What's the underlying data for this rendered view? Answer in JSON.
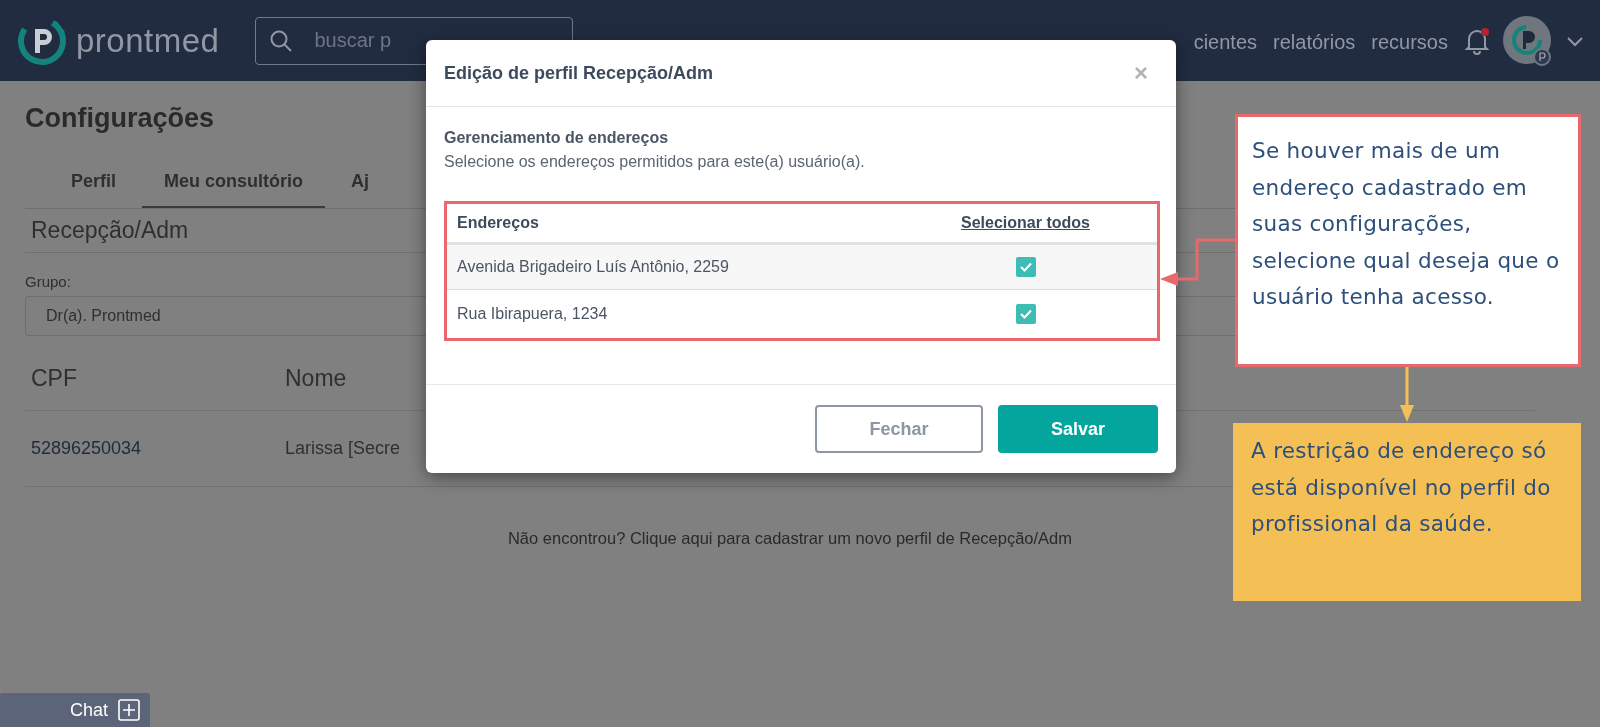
{
  "header": {
    "logo": "prontmed",
    "search": {
      "placeholder": "buscar p"
    },
    "nav": [
      {
        "label": "cientes"
      },
      {
        "label": "relatórios"
      },
      {
        "label": "recursos"
      }
    ]
  },
  "page": {
    "title": "Configurações",
    "tabs": [
      {
        "label": "Perfil",
        "selected": false
      },
      {
        "label": "Meu consultório",
        "selected": true
      },
      {
        "label": "Aj",
        "selected": false
      }
    ],
    "section": "Recepção/Adm",
    "group": {
      "label": "Grupo:",
      "value": "Dr(a). Prontmed"
    },
    "table": {
      "columns": [
        "CPF",
        "Nome"
      ],
      "rows": [
        [
          "52896250034",
          "Larissa [Secre"
        ]
      ]
    },
    "footer_link": "Não encontrou? Clique aqui para cadastrar um novo perfil de Recepção/Adm"
  },
  "modal": {
    "title": "Edição de perfil Recepção/Adm",
    "close": "×",
    "subtitle": "Gerenciamento de endereços",
    "description": "Selecione os endereços permitidos para este(a) usuário(a).",
    "columns": [
      "Endereços",
      "Selecionar todos"
    ],
    "addresses": [
      {
        "label": "Avenida Brigadeiro Luís Antônio, 2259",
        "checked": true
      },
      {
        "label": "Rua Ibirapuera, 1234",
        "checked": true
      }
    ],
    "buttons": [
      {
        "label": "Fechar",
        "kind": "secondary"
      },
      {
        "label": "Salvar",
        "kind": "primary"
      }
    ]
  },
  "callouts": [
    {
      "kind": "note",
      "text": "Se houver mais de um endereço cadastrado em suas configurações, selecione qual deseja que o usuário tenha acesso."
    },
    {
      "kind": "info",
      "text": "A restrição de endereço só está disponível no perfil do profissional da saúde."
    }
  ],
  "chat": {
    "label": "Chat"
  }
}
